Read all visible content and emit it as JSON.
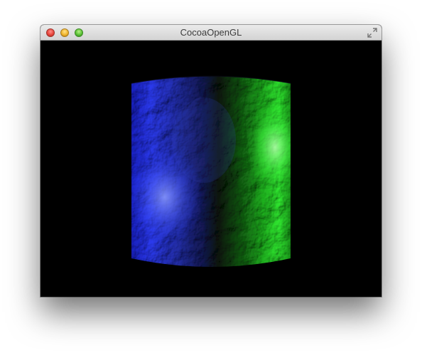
{
  "window": {
    "title": "CocoaOpenGL"
  },
  "controls": {
    "close": "close-button",
    "minimize": "minimize-button",
    "zoom": "zoom-button",
    "fullscreen": "fullscreen-icon"
  },
  "scene": {
    "background_color": "#000000",
    "object": "textured-cylinder",
    "light_left_color": "#2a3bff",
    "light_right_color": "#22ff22"
  }
}
